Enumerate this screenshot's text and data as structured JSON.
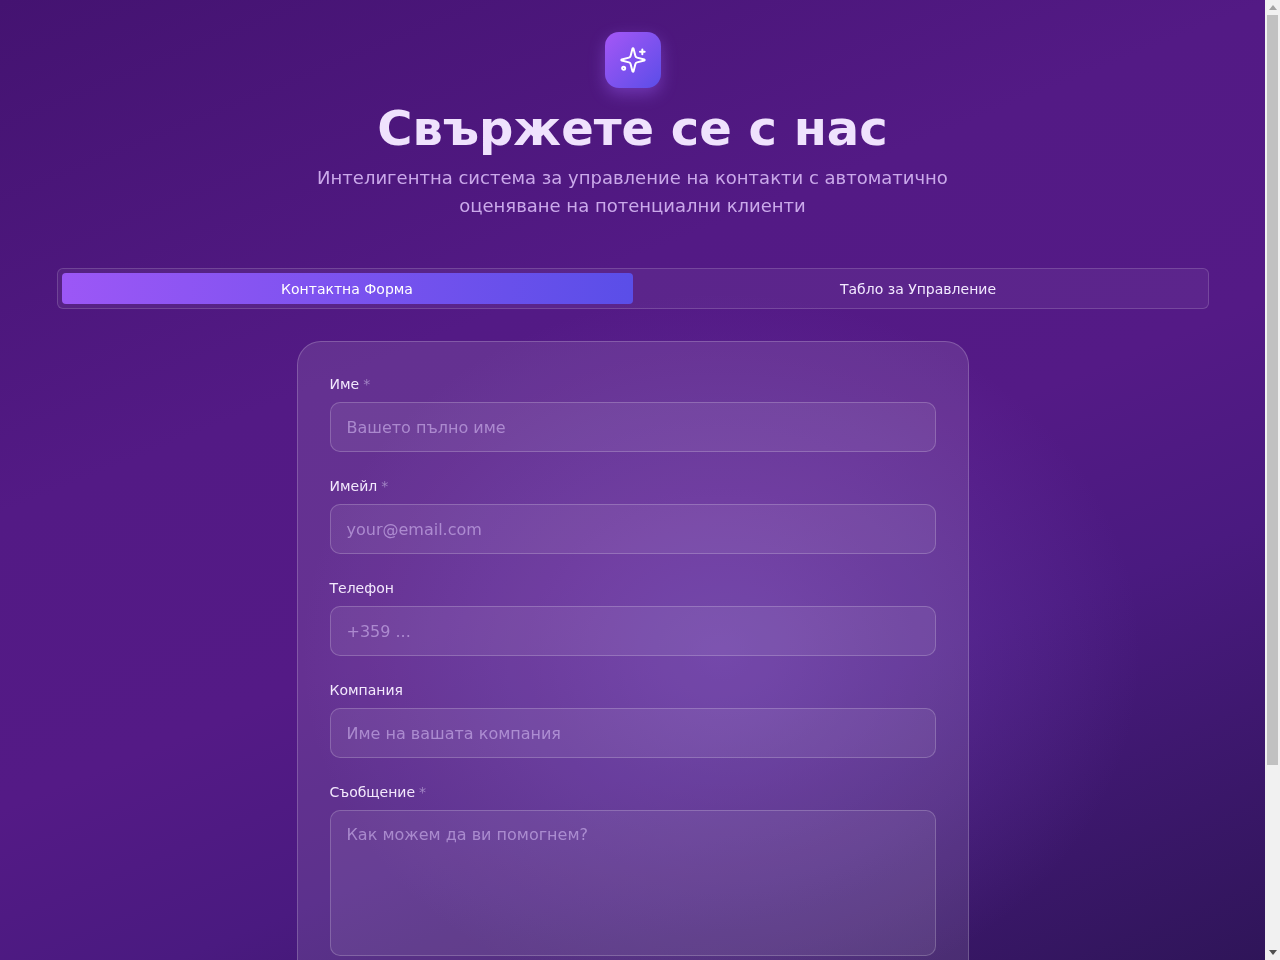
{
  "header": {
    "title": "Свържете се с нас",
    "subtitle": "Интелигентна система за управление на контакти с автоматично оценяване на потенциални клиенти"
  },
  "tabs": [
    {
      "label": "Контактна Форма",
      "selected": true
    },
    {
      "label": "Табло за Управление",
      "selected": false
    }
  ],
  "form": {
    "fields": [
      {
        "kind": "input",
        "label": "Име",
        "required_mark": "*",
        "placeholder": "Вашето пълно име"
      },
      {
        "kind": "input",
        "label": "Имейл",
        "required_mark": "*",
        "placeholder": "your@email.com"
      },
      {
        "kind": "input",
        "label": "Телефон",
        "placeholder": "+359 ..."
      },
      {
        "kind": "input",
        "label": "Компания",
        "placeholder": "Име на вашата компания"
      },
      {
        "kind": "textarea",
        "label": "Съобщение",
        "required_mark": "*",
        "placeholder": "Как можем да ви помогнем?"
      }
    ]
  }
}
